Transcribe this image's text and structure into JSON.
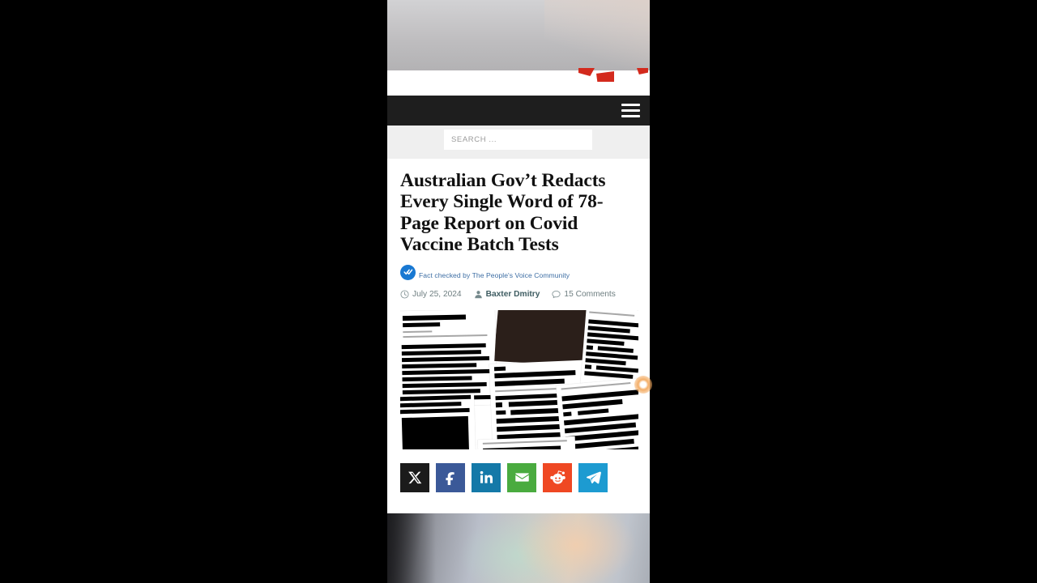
{
  "site": {
    "search": {
      "placeholder": "SEARCH ...",
      "value": ""
    },
    "menu_label": "Menu"
  },
  "article": {
    "headline": "Australian Gov’t Redacts Every Single Word of 78-Page Report on Covid Vaccine Batch Tests",
    "factcheck": {
      "text": "Fact checked by The People's Voice Community",
      "badge_color": "#1878d2"
    },
    "meta": {
      "date": "July 25, 2024",
      "author": "Baxter Dmitry",
      "comments": "15 Comments"
    },
    "image_alt": "Stack of government report pages with every line blacked out by redaction bars"
  },
  "share": {
    "buttons": [
      {
        "name": "x",
        "label": "X",
        "color": "#1b1b1b"
      },
      {
        "name": "facebook",
        "label": "Facebook",
        "color": "#3b5998"
      },
      {
        "name": "linkedin",
        "label": "LinkedIn",
        "color": "#1479a8"
      },
      {
        "name": "email",
        "label": "Email",
        "color": "#4aab3f"
      },
      {
        "name": "reddit",
        "label": "Reddit",
        "color": "#ef4823"
      },
      {
        "name": "telegram",
        "label": "Telegram",
        "color": "#1d9bd1"
      }
    ]
  }
}
